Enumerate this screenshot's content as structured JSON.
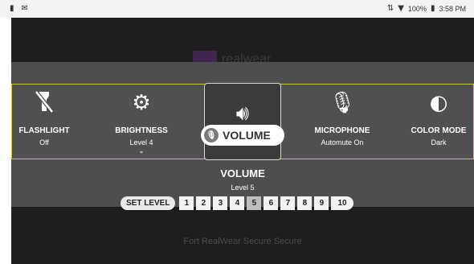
{
  "status_bar": {
    "battery": "100%",
    "time": "3:58 PM"
  },
  "background": {
    "logo_text": "realwear",
    "footer": "Fort RealWear Secure Secure"
  },
  "tiles": [
    {
      "label": "FLASHLIGHT",
      "value": "Off"
    },
    {
      "label": "BRIGHTNESS",
      "value": "Level 4"
    },
    {
      "label": "VOLUME",
      "value": ""
    },
    {
      "label": "MICROPHONE",
      "value": "Automute On"
    },
    {
      "label": "COLOR MODE",
      "value": "Dark"
    }
  ],
  "selected_pill": "VOLUME",
  "detail": {
    "title": "VOLUME",
    "level_text": "Level 5",
    "set_level_label": "SET LEVEL",
    "levels": [
      "1",
      "2",
      "3",
      "4",
      "5",
      "6",
      "7",
      "8",
      "9",
      "10"
    ],
    "current_level": 5
  }
}
